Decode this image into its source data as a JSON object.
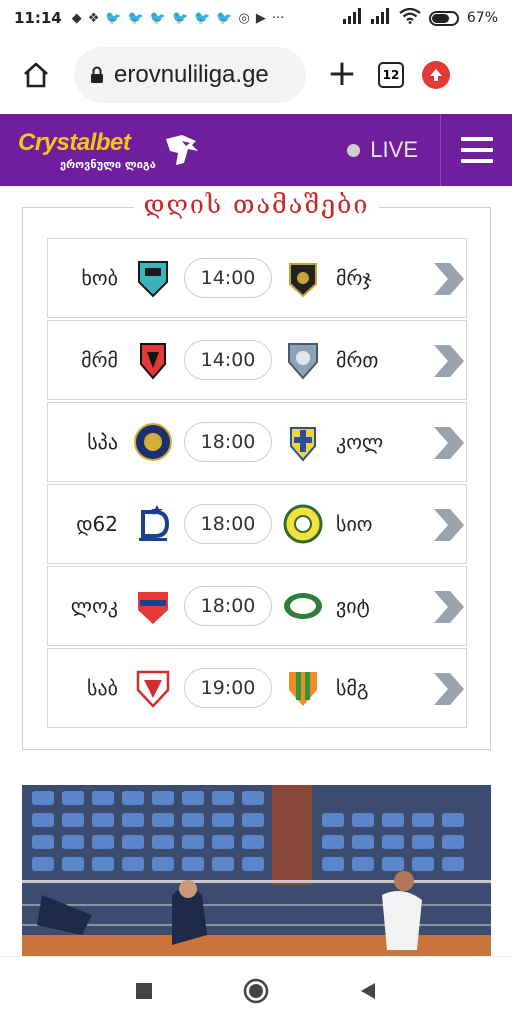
{
  "status_bar": {
    "time": "11:14",
    "battery_percent": "67%",
    "battery_level": 0.67,
    "icons": [
      "network-icon",
      "dropbox-icon",
      "twitter-icon",
      "twitter-icon",
      "twitter-icon",
      "twitter-icon",
      "twitter-icon",
      "twitter-icon",
      "instagram-icon",
      "youtube-icon",
      "more-icon",
      "signal-icon",
      "signal-icon",
      "wifi-icon",
      "battery-icon"
    ],
    "more": "···"
  },
  "browser": {
    "url": "erovnuliliga.ge",
    "tab_count": "12"
  },
  "site": {
    "logo_main": "Crystalbet",
    "logo_sub": "ეროვნული ლიგა",
    "live_label": "LIVE",
    "brand_color": "#6f1e9e",
    "accent_color": "#f5c518"
  },
  "games": {
    "title": "დღის თამაშები",
    "matches": [
      {
        "home": "ხობ",
        "time": "14:00",
        "away": "მრჯ"
      },
      {
        "home": "მრმ",
        "time": "14:00",
        "away": "მრთ"
      },
      {
        "home": "სპა",
        "time": "18:00",
        "away": "კოლ"
      },
      {
        "home": "დ62",
        "time": "18:00",
        "away": "სიო"
      },
      {
        "home": "ლოკ",
        "time": "18:00",
        "away": "ვიტ"
      },
      {
        "home": "საბ",
        "time": "19:00",
        "away": "სმგ"
      }
    ]
  }
}
